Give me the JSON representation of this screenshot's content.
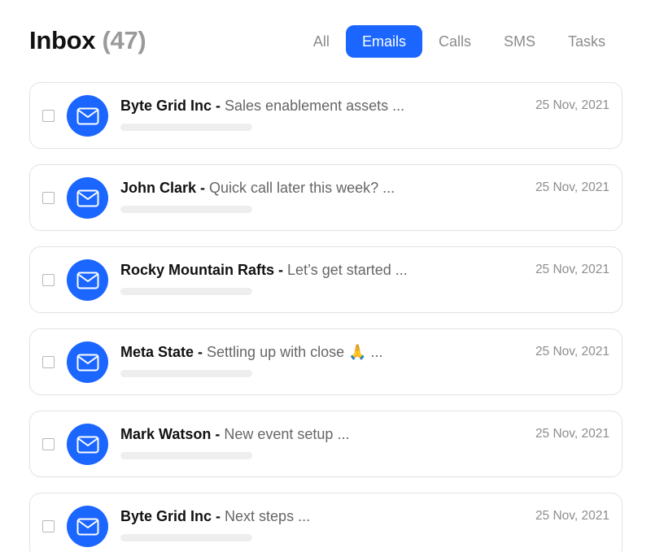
{
  "header": {
    "title": "Inbox",
    "count": "(47)"
  },
  "tabs": [
    {
      "label": "All",
      "active": false
    },
    {
      "label": "Emails",
      "active": true
    },
    {
      "label": "Calls",
      "active": false
    },
    {
      "label": "SMS",
      "active": false
    },
    {
      "label": "Tasks",
      "active": false
    }
  ],
  "messages": [
    {
      "sender": "Byte Grid Inc",
      "separator": " - ",
      "subject": "Sales enablement assets ...",
      "date": "25 Nov, 2021",
      "icon": "envelope-icon"
    },
    {
      "sender": "John Clark",
      "separator": " - ",
      "subject": "Quick call later this week? ...",
      "date": "25 Nov, 2021",
      "icon": "envelope-icon"
    },
    {
      "sender": "Rocky Mountain Rafts",
      "separator": " - ",
      "subject": "Let’s get started ...",
      "date": "25 Nov, 2021",
      "icon": "envelope-icon"
    },
    {
      "sender": "Meta State",
      "separator": " - ",
      "subject": "Settling up with close 🙏 ...",
      "date": "25 Nov, 2021",
      "icon": "envelope-icon"
    },
    {
      "sender": "Mark Watson",
      "separator": " - ",
      "subject": "New event setup ...",
      "date": "25 Nov, 2021",
      "icon": "envelope-icon"
    },
    {
      "sender": "Byte Grid Inc",
      "separator": " - ",
      "subject": "Next steps ...",
      "date": "25 Nov, 2021",
      "icon": "envelope-icon"
    }
  ],
  "colors": {
    "accent": "#1a66ff",
    "count": "#9a9a9a",
    "subject": "#666666",
    "date": "#8d8d8d"
  }
}
